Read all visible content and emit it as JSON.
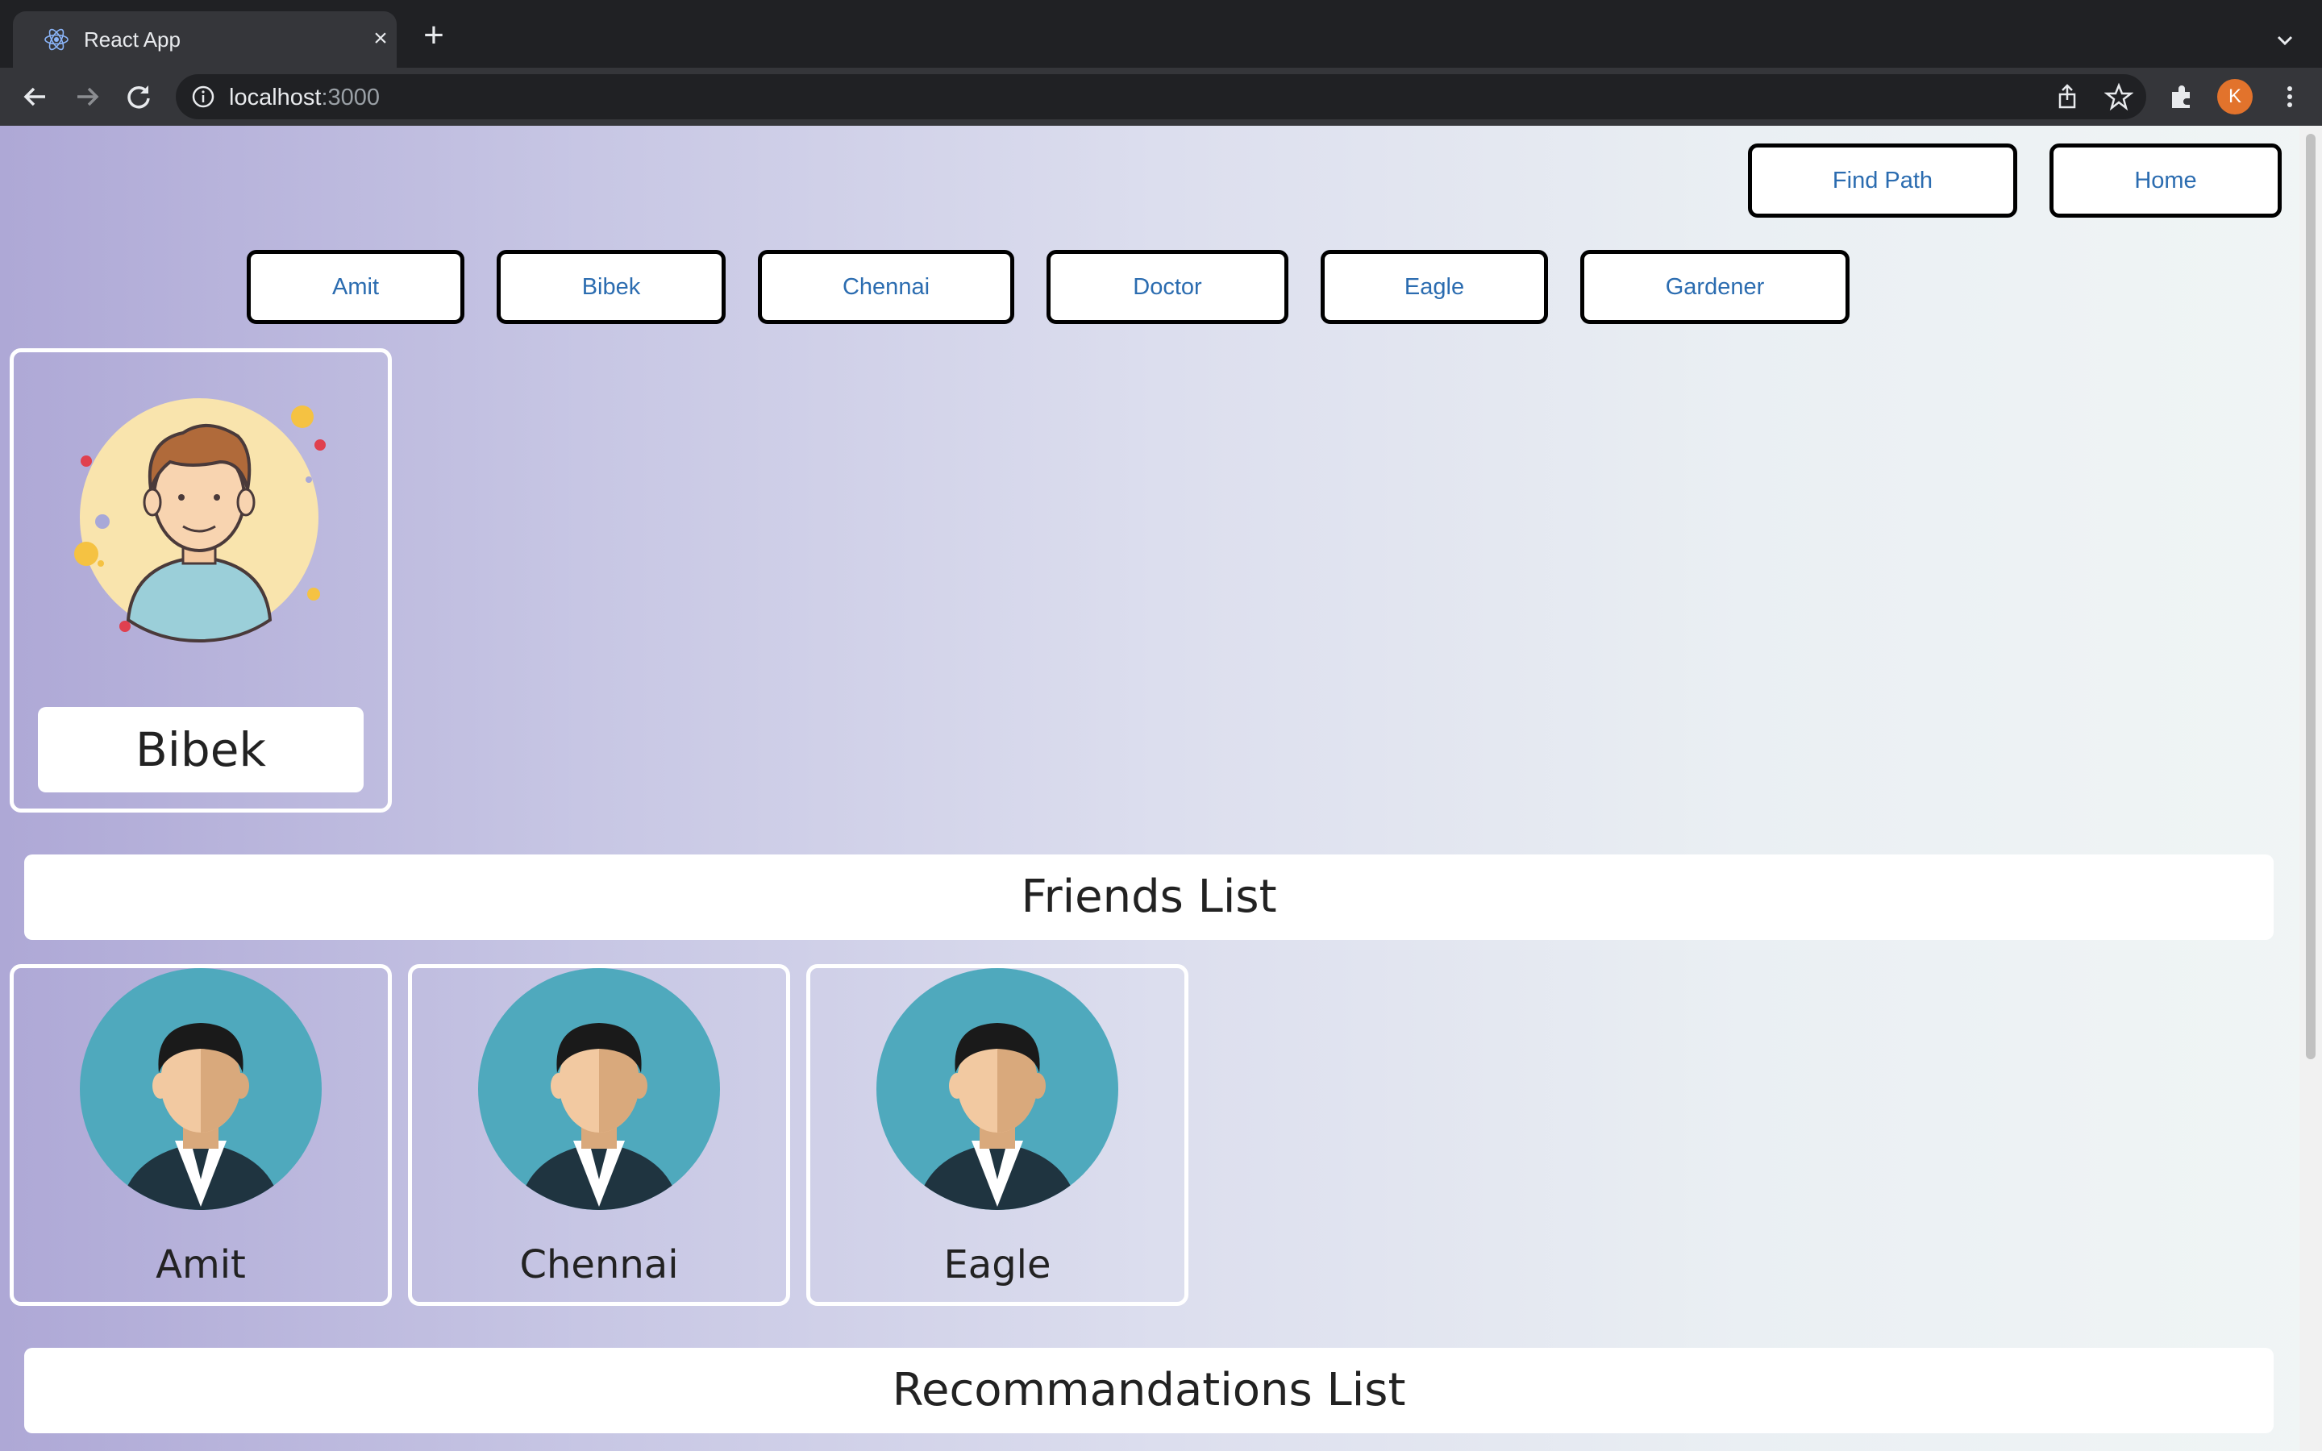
{
  "browser": {
    "tab_title": "React App",
    "url_host": "localhost",
    "url_port": ":3000",
    "profile_initial": "K"
  },
  "header": {
    "find_path_label": "Find Path",
    "home_label": "Home"
  },
  "people_nav": [
    {
      "label": "Amit"
    },
    {
      "label": "Bibek"
    },
    {
      "label": "Chennai"
    },
    {
      "label": "Doctor"
    },
    {
      "label": "Eagle"
    },
    {
      "label": "Gardener"
    }
  ],
  "profile": {
    "name": "Bibek",
    "avatar": "cartoon-man-avatar"
  },
  "friends": {
    "title": "Friends List",
    "items": [
      {
        "name": "Amit",
        "avatar": "businessman-avatar"
      },
      {
        "name": "Chennai",
        "avatar": "businessman-avatar"
      },
      {
        "name": "Eagle",
        "avatar": "businessman-avatar"
      }
    ]
  },
  "recommendations": {
    "title": "Recommandations List"
  },
  "colors": {
    "button_text": "#2b6cb0",
    "avatar_teal": "#4fa9bd",
    "profile_bg": "#f9e4ad"
  }
}
